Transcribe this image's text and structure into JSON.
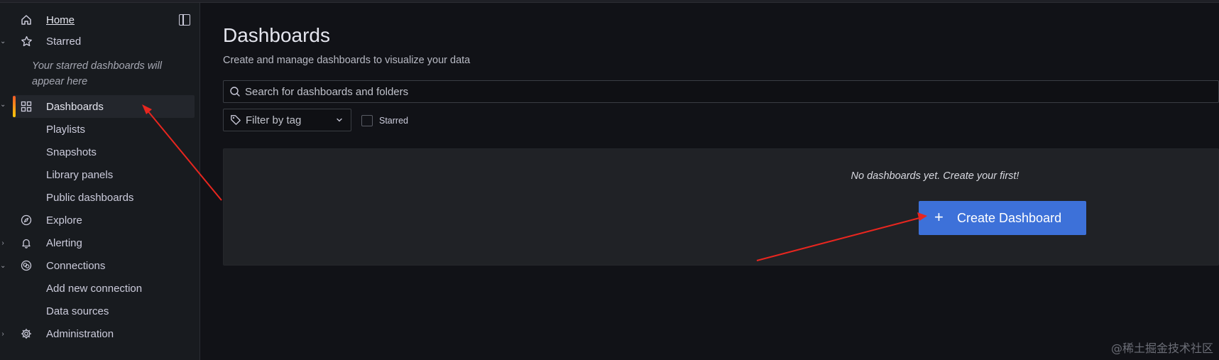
{
  "sidebar": {
    "home": "Home",
    "starred": "Starred",
    "starred_empty": "Your starred dashboards will appear here",
    "dashboards": "Dashboards",
    "dashboards_children": [
      "Playlists",
      "Snapshots",
      "Library panels",
      "Public dashboards"
    ],
    "explore": "Explore",
    "alerting": "Alerting",
    "connections": "Connections",
    "connections_children": [
      "Add new connection",
      "Data sources"
    ],
    "administration": "Administration"
  },
  "main": {
    "title": "Dashboards",
    "subtitle": "Create and manage dashboards to visualize your data",
    "search_placeholder": "Search for dashboards and folders",
    "tag_filter_label": "Filter by tag",
    "starred_filter_label": "Starred",
    "starred_filter_checked": false,
    "empty_message": "No dashboards yet. Create your first!",
    "create_button": "Create Dashboard"
  },
  "watermark": "@稀土掘金技术社区",
  "colors": {
    "primary_button": "#3d71d9",
    "annotation_arrow": "#e8261f",
    "active_indicator": "#f05a28"
  }
}
